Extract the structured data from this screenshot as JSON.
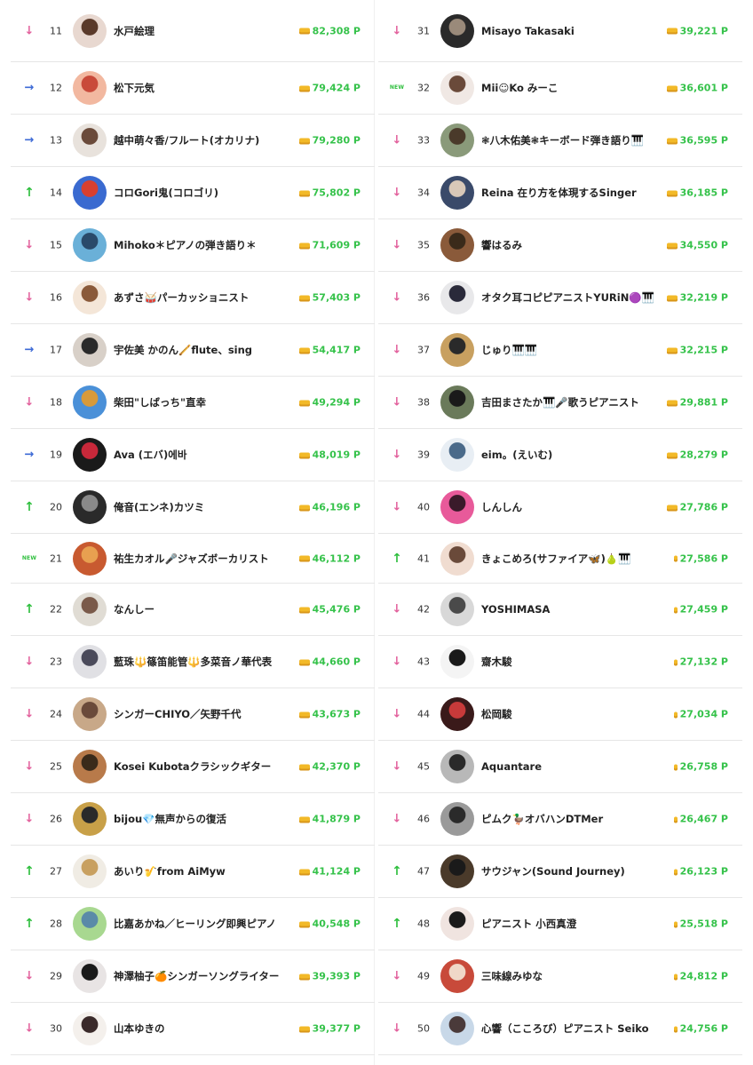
{
  "left_column": [
    {
      "trend": "down",
      "rank": "11",
      "name": "水戸絵理",
      "points": "82,308 P",
      "avatar_colors": [
        "#e8d8d0",
        "#5a3a2a"
      ]
    },
    {
      "trend": "same",
      "rank": "12",
      "name": "松下元気",
      "points": "79,424 P",
      "avatar_colors": [
        "#f2b8a0",
        "#c94a3a"
      ]
    },
    {
      "trend": "same",
      "rank": "13",
      "name": "越中萌々香/フルート(オカリナ)",
      "points": "79,280 P",
      "avatar_colors": [
        "#e8e2dc",
        "#6a4a3a"
      ]
    },
    {
      "trend": "up",
      "rank": "14",
      "name": "コロGori鬼(コロゴリ)",
      "points": "75,802 P",
      "avatar_colors": [
        "#3a6ad0",
        "#d84030"
      ]
    },
    {
      "trend": "down",
      "rank": "15",
      "name": "Mihoko＊ピアノの弾き語り＊",
      "points": "71,609 P",
      "avatar_colors": [
        "#6ab0d8",
        "#2a4a6a"
      ]
    },
    {
      "trend": "down",
      "rank": "16",
      "name": "あずさ🥁パーカッショニスト",
      "points": "57,403 P",
      "avatar_colors": [
        "#f4e6d8",
        "#8a5a3a"
      ]
    },
    {
      "trend": "same",
      "rank": "17",
      "name": "宇佐美 かのん🪈flute、sing",
      "points": "54,417 P",
      "avatar_colors": [
        "#d8d0c8",
        "#2a2a2a"
      ]
    },
    {
      "trend": "down",
      "rank": "18",
      "name": "柴田\"しばっち\"直幸",
      "points": "49,294 P",
      "avatar_colors": [
        "#4a90d8",
        "#d89a3a"
      ]
    },
    {
      "trend": "same",
      "rank": "19",
      "name": "Ava (エバ)에바",
      "points": "48,019 P",
      "avatar_colors": [
        "#1a1a1a",
        "#c8283a"
      ]
    },
    {
      "trend": "up",
      "rank": "20",
      "name": "俺音(エンネ)カツミ",
      "points": "46,196 P",
      "avatar_colors": [
        "#2a2a2a",
        "#8a8a8a"
      ]
    },
    {
      "trend": "new",
      "rank": "21",
      "name": "祐生カオル🎤ジャズボーカリスト",
      "points": "46,112 P",
      "avatar_colors": [
        "#c85a30",
        "#e8a050"
      ]
    },
    {
      "trend": "up",
      "rank": "22",
      "name": "なんしー",
      "points": "45,476 P",
      "avatar_colors": [
        "#e0dcd4",
        "#7a5a4a"
      ]
    },
    {
      "trend": "down",
      "rank": "23",
      "name": "藍珠🔱篠笛能管🔱多菜音ノ華代表",
      "points": "44,660 P",
      "avatar_colors": [
        "#e0e0e4",
        "#4a4a5a"
      ]
    },
    {
      "trend": "down",
      "rank": "24",
      "name": "シンガーCHIYO／矢野千代",
      "points": "43,673 P",
      "avatar_colors": [
        "#c8a888",
        "#6a4a3a"
      ]
    },
    {
      "trend": "down",
      "rank": "25",
      "name": "Kosei Kubotaクラシックギター",
      "points": "42,370 P",
      "avatar_colors": [
        "#b87a4a",
        "#3a2a1a"
      ]
    },
    {
      "trend": "down",
      "rank": "26",
      "name": "bijou💎無声からの復活",
      "points": "41,879 P",
      "avatar_colors": [
        "#c8a048",
        "#2a2a2a"
      ]
    },
    {
      "trend": "up",
      "rank": "27",
      "name": "あいり🎷from AiMyw",
      "points": "41,124 P",
      "avatar_colors": [
        "#f0ece4",
        "#c8a060"
      ]
    },
    {
      "trend": "up",
      "rank": "28",
      "name": "比嘉あかね／ヒーリング即興ピアノ",
      "points": "40,548 P",
      "avatar_colors": [
        "#a8d890",
        "#5a8aa8"
      ]
    },
    {
      "trend": "down",
      "rank": "29",
      "name": "神澤柚子🍊シンガーソングライター",
      "points": "39,393 P",
      "avatar_colors": [
        "#e8e4e4",
        "#1a1a1a"
      ]
    },
    {
      "trend": "down",
      "rank": "30",
      "name": "山本ゆきの",
      "points": "39,377 P",
      "avatar_colors": [
        "#f4f0ec",
        "#3a2a2a"
      ]
    }
  ],
  "right_column": [
    {
      "trend": "down",
      "rank": "31",
      "name": "Misayo Takasaki",
      "points": "39,221 P",
      "avatar_colors": [
        "#2a2a2a",
        "#9a8a7a"
      ]
    },
    {
      "trend": "new",
      "rank": "32",
      "name": "Mii☺Ko みーこ",
      "points": "36,601 P",
      "avatar_colors": [
        "#f0e8e4",
        "#6a4a3a"
      ]
    },
    {
      "trend": "down",
      "rank": "33",
      "name": "❃八木佑美❃キーボード弾き語り🎹",
      "points": "36,595 P",
      "avatar_colors": [
        "#8a9a7a",
        "#4a3a2a"
      ]
    },
    {
      "trend": "down",
      "rank": "34",
      "name": "Reina 在り方を体現するSinger",
      "points": "36,185 P",
      "avatar_colors": [
        "#3a4a6a",
        "#d8c8b8"
      ]
    },
    {
      "trend": "down",
      "rank": "35",
      "name": "響はるみ",
      "points": "34,550 P",
      "avatar_colors": [
        "#8a5a3a",
        "#3a2a1a"
      ]
    },
    {
      "trend": "down",
      "rank": "36",
      "name": "オタク耳コピピアニストYURiN🟣🎹",
      "points": "32,219 P",
      "avatar_colors": [
        "#e8e8ea",
        "#2a2a3a"
      ]
    },
    {
      "trend": "down",
      "rank": "37",
      "name": "じゅり🎹🎹",
      "points": "32,215 P",
      "avatar_colors": [
        "#c8a060",
        "#2a2a2a"
      ]
    },
    {
      "trend": "down",
      "rank": "38",
      "name": "吉田まさたか🎹🎤歌うピアニスト",
      "points": "29,881 P",
      "avatar_colors": [
        "#6a7a5a",
        "#1a1a1a"
      ]
    },
    {
      "trend": "down",
      "rank": "39",
      "name": "eim。(えいむ)",
      "points": "28,279 P",
      "avatar_colors": [
        "#e8eef4",
        "#4a6a8a"
      ]
    },
    {
      "trend": "down",
      "rank": "40",
      "name": "しんしん",
      "points": "27,786 P",
      "avatar_colors": [
        "#e85a9a",
        "#3a1a2a"
      ]
    },
    {
      "trend": "up",
      "rank": "41",
      "name": "きょこめろ(サファイア🦋)🍐🎹",
      "points": "27,586 P",
      "avatar_colors": [
        "#f0dcd0",
        "#6a4a3a"
      ]
    },
    {
      "trend": "down",
      "rank": "42",
      "name": "YOSHIMASA",
      "points": "27,459 P",
      "avatar_colors": [
        "#d8d8d8",
        "#4a4a4a"
      ]
    },
    {
      "trend": "down",
      "rank": "43",
      "name": "齋木駿",
      "points": "27,132 P",
      "avatar_colors": [
        "#f4f4f4",
        "#1a1a1a"
      ]
    },
    {
      "trend": "down",
      "rank": "44",
      "name": "松岡駿",
      "points": "27,034 P",
      "avatar_colors": [
        "#3a1a1a",
        "#c83a3a"
      ]
    },
    {
      "trend": "down",
      "rank": "45",
      "name": "Aquantare",
      "points": "26,758 P",
      "avatar_colors": [
        "#b8b8b8",
        "#2a2a2a"
      ]
    },
    {
      "trend": "down",
      "rank": "46",
      "name": "ピムク🦆オバハンDTMer",
      "points": "26,467 P",
      "avatar_colors": [
        "#9a9a9a",
        "#2a2a2a"
      ]
    },
    {
      "trend": "up",
      "rank": "47",
      "name": "サウジャン(Sound Journey)",
      "points": "26,123 P",
      "avatar_colors": [
        "#4a3a2a",
        "#1a1a1a"
      ]
    },
    {
      "trend": "up",
      "rank": "48",
      "name": "ピアニスト 小西真澄",
      "points": "25,518 P",
      "avatar_colors": [
        "#f0e4e0",
        "#1a1a1a"
      ]
    },
    {
      "trend": "down",
      "rank": "49",
      "name": "三味線みゆな",
      "points": "24,812 P",
      "avatar_colors": [
        "#c84a3a",
        "#f0d8c8"
      ]
    },
    {
      "trend": "down",
      "rank": "50",
      "name": "心響（こころび）ピアニスト Seiko",
      "points": "24,756 P",
      "avatar_colors": [
        "#c8d8e8",
        "#4a3a3a"
      ]
    }
  ],
  "trend_glyphs": {
    "up": "↑",
    "down": "↓",
    "same": "→",
    "new": "NEW"
  },
  "colors": {
    "points_green": "#35c24a",
    "trend_down": "#e2609c",
    "trend_up": "#2fbf3e",
    "trend_same": "#3d6ad6",
    "coin": "#f2b928"
  }
}
